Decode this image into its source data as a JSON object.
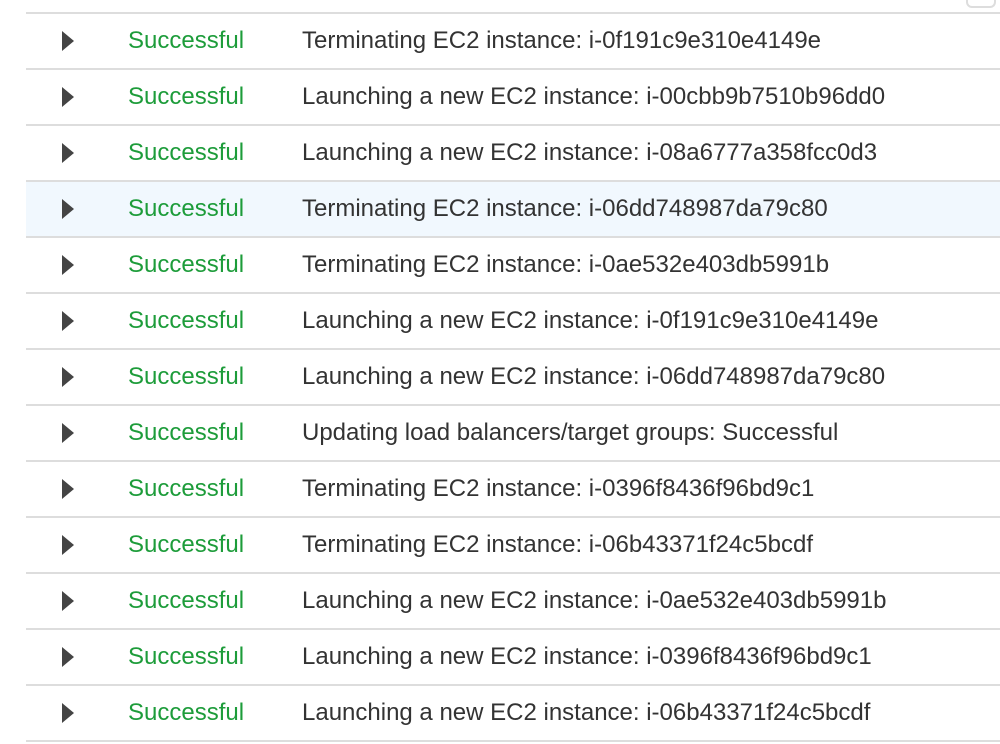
{
  "colors": {
    "status_success": "#1d9c3a",
    "row_highlight": "#f1f8fe"
  },
  "activity": {
    "rows": [
      {
        "status": "Successful",
        "description": "Terminating EC2 instance: i-0f191c9e310e4149e"
      },
      {
        "status": "Successful",
        "description": "Launching a new EC2 instance: i-00cbb9b7510b96dd0"
      },
      {
        "status": "Successful",
        "description": "Launching a new EC2 instance: i-08a6777a358fcc0d3"
      },
      {
        "status": "Successful",
        "description": "Terminating EC2 instance: i-06dd748987da79c80",
        "highlighted": true
      },
      {
        "status": "Successful",
        "description": "Terminating EC2 instance: i-0ae532e403db5991b"
      },
      {
        "status": "Successful",
        "description": "Launching a new EC2 instance: i-0f191c9e310e4149e"
      },
      {
        "status": "Successful",
        "description": "Launching a new EC2 instance: i-06dd748987da79c80"
      },
      {
        "status": "Successful",
        "description": "Updating load balancers/target groups: Successful"
      },
      {
        "status": "Successful",
        "description": "Terminating EC2 instance: i-0396f8436f96bd9c1"
      },
      {
        "status": "Successful",
        "description": "Terminating EC2 instance: i-06b43371f24c5bcdf"
      },
      {
        "status": "Successful",
        "description": "Launching a new EC2 instance: i-0ae532e403db5991b"
      },
      {
        "status": "Successful",
        "description": "Launching a new EC2 instance: i-0396f8436f96bd9c1"
      },
      {
        "status": "Successful",
        "description": "Launching a new EC2 instance: i-06b43371f24c5bcdf"
      }
    ]
  }
}
